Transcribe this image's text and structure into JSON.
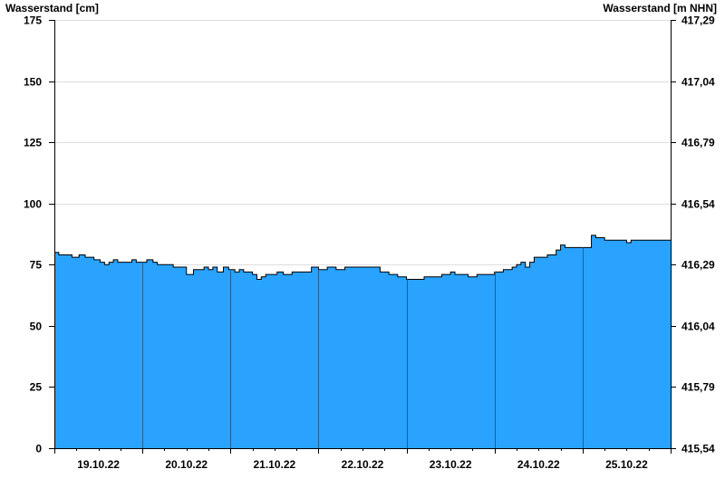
{
  "chart_data": {
    "type": "area",
    "left_axis_title": "Wasserstand [cm]",
    "right_axis_title": "Wasserstand [m NHN]",
    "ylim": [
      0,
      175
    ],
    "y_ticks": [
      "0",
      "25",
      "50",
      "75",
      "100",
      "125",
      "150",
      "175"
    ],
    "right_ticks": [
      "415,54",
      "415,79",
      "416,04",
      "416,29",
      "416,54",
      "416,79",
      "417,04",
      "417,29"
    ],
    "x_range": [
      0,
      7
    ],
    "day_labels": [
      "19.10.22",
      "20.10.22",
      "21.10.22",
      "22.10.22",
      "23.10.22",
      "24.10.22",
      "25.10.22"
    ],
    "grid": true,
    "fill_color": "#29a3ff",
    "line_color": "#000000",
    "series": [
      {
        "x": [
          0.0,
          0.05,
          0.2,
          0.28,
          0.35,
          0.45,
          0.52,
          0.57,
          0.62,
          0.67,
          0.72,
          0.8,
          0.88,
          0.93,
          0.98,
          1.05,
          1.12,
          1.17,
          1.22,
          1.3,
          1.35,
          1.5,
          1.58,
          1.7,
          1.75,
          1.8,
          1.85,
          1.92,
          1.98,
          2.05,
          2.1,
          2.15,
          2.2,
          2.25,
          2.3,
          2.35,
          2.4,
          2.47,
          2.53,
          2.6,
          2.65,
          2.7,
          2.75,
          2.82,
          2.92,
          3.0,
          3.1,
          3.2,
          3.3,
          3.4,
          3.5,
          3.6,
          3.7,
          3.8,
          3.9,
          4.0,
          4.2,
          4.35,
          4.4,
          4.45,
          4.5,
          4.55,
          4.62,
          4.7,
          4.8,
          5.0,
          5.1,
          5.2,
          5.25,
          5.3,
          5.35,
          5.4,
          5.45,
          5.5,
          5.6,
          5.7,
          5.75,
          5.8,
          5.9,
          6.0,
          6.1,
          6.15,
          6.2,
          6.25,
          6.3,
          6.4,
          6.5,
          6.55,
          6.65,
          6.8,
          6.9,
          7.0
        ],
        "y": [
          80,
          79,
          78,
          79,
          78,
          77,
          76,
          75,
          76,
          77,
          76,
          76,
          77,
          76,
          76,
          77,
          76,
          75,
          75,
          75,
          74,
          71,
          73,
          74,
          73,
          74,
          72,
          74,
          73,
          72,
          73,
          72,
          72,
          71,
          69,
          70,
          71,
          71,
          72,
          71,
          71,
          72,
          72,
          72,
          74,
          73,
          74,
          73,
          74,
          74,
          74,
          74,
          72,
          71,
          70,
          69,
          70,
          70,
          71,
          71,
          72,
          71,
          71,
          70,
          71,
          72,
          73,
          74,
          75,
          76,
          74,
          76,
          78,
          78,
          79,
          81,
          83,
          82,
          82,
          82,
          87,
          86,
          86,
          85,
          85,
          85,
          84,
          85,
          85,
          85,
          85,
          85
        ]
      }
    ]
  }
}
